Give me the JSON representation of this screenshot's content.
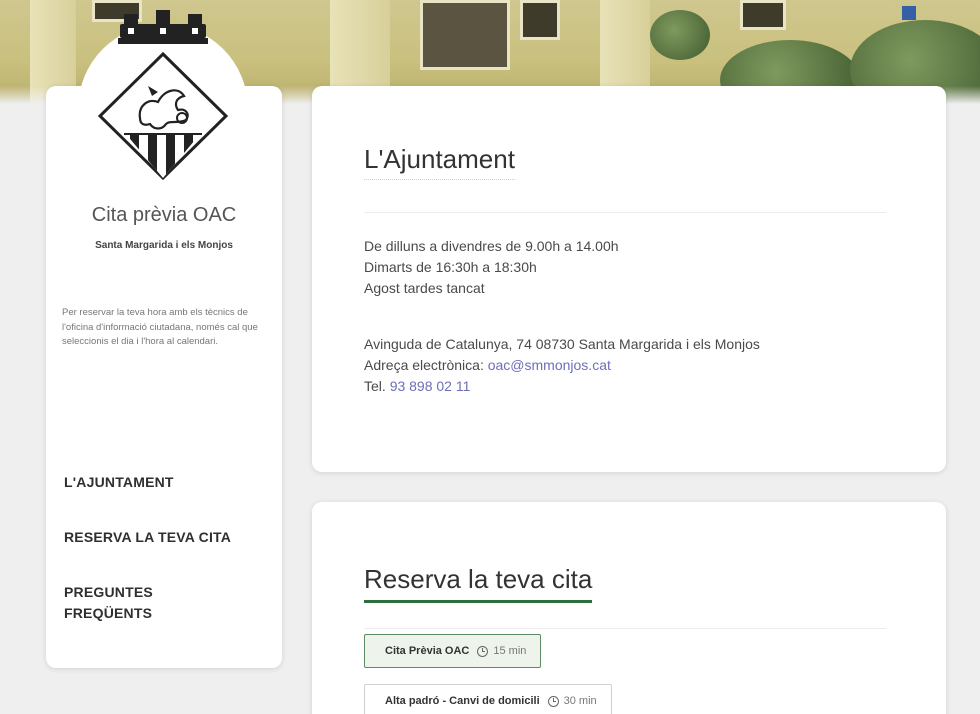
{
  "site": {
    "title": "Cita prèvia OAC",
    "subtitle": "Santa Margarida i els Monjos",
    "description": "Per reservar la teva hora amb els tècnics de l'oficina d'informació ciutadana, només cal que seleccionis el dia i l'hora al calendari."
  },
  "nav": [
    {
      "label": "L'AJUNTAMENT"
    },
    {
      "label": "RESERVA LA TEVA CITA"
    },
    {
      "label": "PREGUNTES FREQÜENTS"
    }
  ],
  "ajuntament": {
    "heading": "L'Ajuntament",
    "hours": [
      "De dilluns a divendres de 9.00h a 14.00h",
      "Dimarts de 16:30h a 18:30h",
      "Agost tardes tancat"
    ],
    "address": "Avinguda de Catalunya, 74 08730 Santa Margarida i els Monjos",
    "email_label": "Adreça electrònica: ",
    "email": "oac@smmonjos.cat",
    "phone_label": "Tel. ",
    "phone": "93 898 02 11"
  },
  "reserva": {
    "heading": "Reserva la teva cita",
    "services": [
      {
        "name": "Cita Prèvia OAC",
        "duration": "15 min",
        "selected": true
      },
      {
        "name": "Alta padró - Canvi de domicili",
        "duration": "30 min",
        "selected": false
      }
    ]
  },
  "colors": {
    "accent": "#2f6e3c",
    "link": "#6d6fb8"
  }
}
